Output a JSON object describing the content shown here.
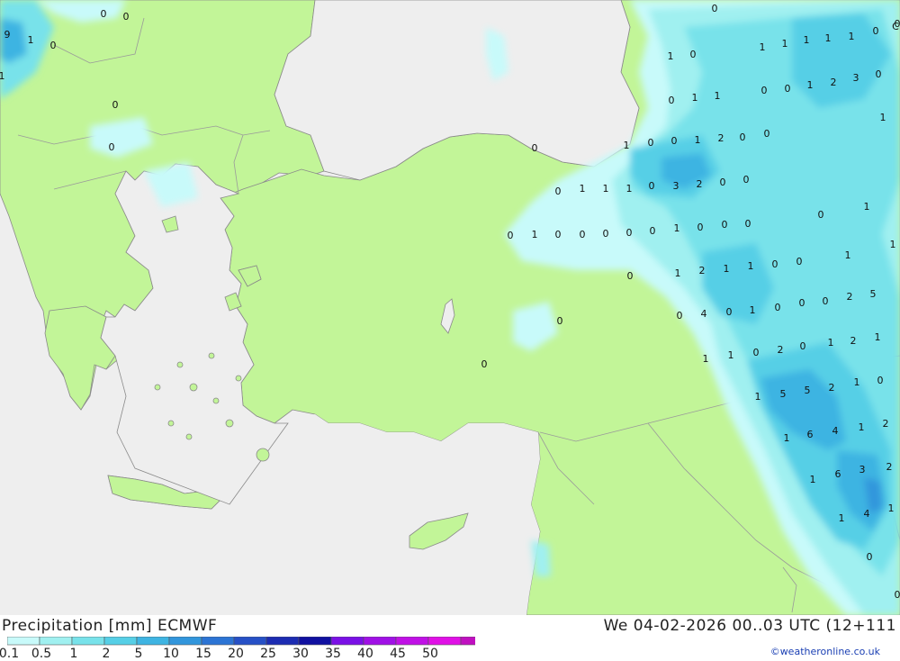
{
  "map": {
    "colors": {
      "sea": "#eeeeee",
      "land": "#c2f598",
      "border": "#9a9a9a",
      "coast": "#8a8a8a"
    },
    "value_labels": [
      {
        "v": "9"
      },
      {
        "v": "1"
      },
      {
        "v": "0"
      },
      {
        "v": "1"
      },
      {
        "v": "0"
      },
      {
        "v": "0"
      },
      {
        "v": "0"
      },
      {
        "v": "0"
      },
      {
        "v": "0"
      },
      {
        "v": "1"
      },
      {
        "v": "0"
      },
      {
        "v": "1"
      },
      {
        "v": "1"
      },
      {
        "v": "1"
      },
      {
        "v": "1"
      },
      {
        "v": "1"
      },
      {
        "v": "0"
      },
      {
        "v": "0"
      },
      {
        "v": "0"
      },
      {
        "v": "1"
      },
      {
        "v": "2"
      },
      {
        "v": "3"
      },
      {
        "v": "0"
      },
      {
        "v": "1"
      },
      {
        "v": "0"
      },
      {
        "v": "1"
      },
      {
        "v": "1"
      },
      {
        "v": "0"
      },
      {
        "v": "1"
      },
      {
        "v": "0"
      },
      {
        "v": "0"
      },
      {
        "v": "1"
      },
      {
        "v": "2"
      },
      {
        "v": "0"
      },
      {
        "v": "0"
      },
      {
        "v": "0"
      },
      {
        "v": "1"
      },
      {
        "v": "1"
      },
      {
        "v": "1"
      },
      {
        "v": "0"
      },
      {
        "v": "3"
      },
      {
        "v": "2"
      },
      {
        "v": "0"
      },
      {
        "v": "0"
      },
      {
        "v": "0"
      },
      {
        "v": "1"
      },
      {
        "v": "0"
      },
      {
        "v": "1"
      },
      {
        "v": "0"
      },
      {
        "v": "0"
      },
      {
        "v": "0"
      },
      {
        "v": "0"
      },
      {
        "v": "0"
      },
      {
        "v": "1"
      },
      {
        "v": "0"
      },
      {
        "v": "0"
      },
      {
        "v": "0"
      },
      {
        "v": "0"
      },
      {
        "v": "1"
      },
      {
        "v": "1"
      },
      {
        "v": "0"
      },
      {
        "v": "1"
      },
      {
        "v": "2"
      },
      {
        "v": "1"
      },
      {
        "v": "1"
      },
      {
        "v": "0"
      },
      {
        "v": "0"
      },
      {
        "v": "4"
      },
      {
        "v": "0"
      },
      {
        "v": "1"
      },
      {
        "v": "0"
      },
      {
        "v": "0"
      },
      {
        "v": "0"
      },
      {
        "v": "2"
      },
      {
        "v": "5"
      },
      {
        "v": "0"
      },
      {
        "v": "0"
      },
      {
        "v": "0"
      },
      {
        "v": "1"
      },
      {
        "v": "1"
      },
      {
        "v": "0"
      },
      {
        "v": "2"
      },
      {
        "v": "0"
      },
      {
        "v": "1"
      },
      {
        "v": "2"
      },
      {
        "v": "1"
      },
      {
        "v": "1"
      },
      {
        "v": "5"
      },
      {
        "v": "5"
      },
      {
        "v": "2"
      },
      {
        "v": "1"
      },
      {
        "v": "0"
      },
      {
        "v": "1"
      },
      {
        "v": "6"
      },
      {
        "v": "4"
      },
      {
        "v": "1"
      },
      {
        "v": "2"
      },
      {
        "v": "1"
      },
      {
        "v": "6"
      },
      {
        "v": "3"
      },
      {
        "v": "2"
      },
      {
        "v": "1"
      },
      {
        "v": "4"
      },
      {
        "v": "1"
      },
      {
        "v": "0"
      },
      {
        "v": "0"
      },
      {
        "v": "C"
      }
    ]
  },
  "footer": {
    "title": "Precipitation [mm] ECMWF",
    "valid": "We 04-02-2026 00..03 UTC (12+111",
    "credit": "©weatheronline.co.uk",
    "legend": {
      "colors": [
        "#c8fafa",
        "#a0f0f0",
        "#78e2ea",
        "#56cfe6",
        "#3eb4e2",
        "#3296dc",
        "#2c74d4",
        "#2650c6",
        "#1c2cb2",
        "#1010a0",
        "#7a10e6",
        "#a010e6",
        "#c010e6",
        "#e010e6",
        "#c010c0",
        "#a010b0"
      ],
      "labels": [
        "0.1",
        "0.5",
        "1",
        "2",
        "5",
        "10",
        "15",
        "20",
        "25",
        "30",
        "35",
        "40",
        "45",
        "50"
      ]
    }
  }
}
